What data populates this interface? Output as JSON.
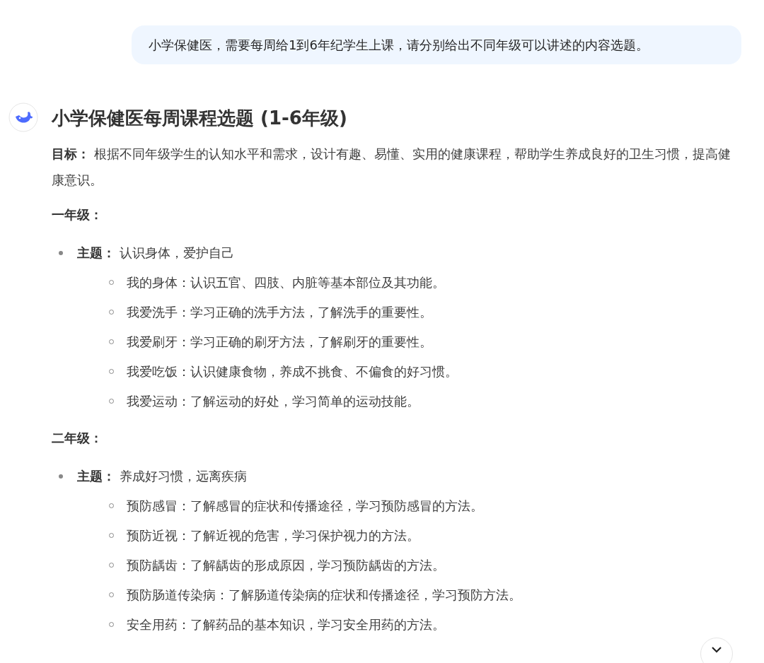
{
  "user_message": "小学保健医，需要每周给1到6年纪学生上课，请分别给出不同年级可以讲述的内容选题。",
  "response": {
    "title": "小学保健医每周课程选题 (1-6年级)",
    "goal": "**目标：** 根据不同年级学生的认知水平和需求，设计有趣、易懂、实用的健康课程，帮助学生养成良好的卫生习惯，提高健康意识。",
    "sections": [
      {
        "heading": "一年级：",
        "items": [
          {
            "text": "**主题：** 认识身体，爱护自己",
            "children": [
              {
                "text": "我的身体：认识五官、四肢、内脏等基本部位及其功能。"
              },
              {
                "text": "我爱洗手：学习正确的洗手方法，了解洗手的重要性。"
              },
              {
                "text": "我爱刷牙：学习正确的刷牙方法，了解刷牙的重要性。"
              },
              {
                "text": "我爱吃饭：认识健康食物，养成不挑食、不偏食的好习惯。"
              },
              {
                "text": "我爱运动：了解运动的好处，学习简单的运动技能。"
              }
            ]
          }
        ]
      },
      {
        "heading": "二年级：",
        "items": [
          {
            "text": "**主题：** 养成好习惯，远离疾病",
            "children": [
              {
                "text": "预防感冒：了解感冒的症状和传播途径，学习预防感冒的方法。"
              },
              {
                "text": "预防近视：了解近视的危害，学习保护视力的方法。"
              },
              {
                "text": "预防龋齿：了解龋齿的形成原因，学习预防龋齿的方法。"
              },
              {
                "text": "预防肠道传染病：了解肠道传染病的症状和传播途径，学习预防方法。"
              },
              {
                "text": "安全用药：了解药品的基本知识，学习安全用药的方法。"
              }
            ]
          }
        ]
      }
    ]
  }
}
